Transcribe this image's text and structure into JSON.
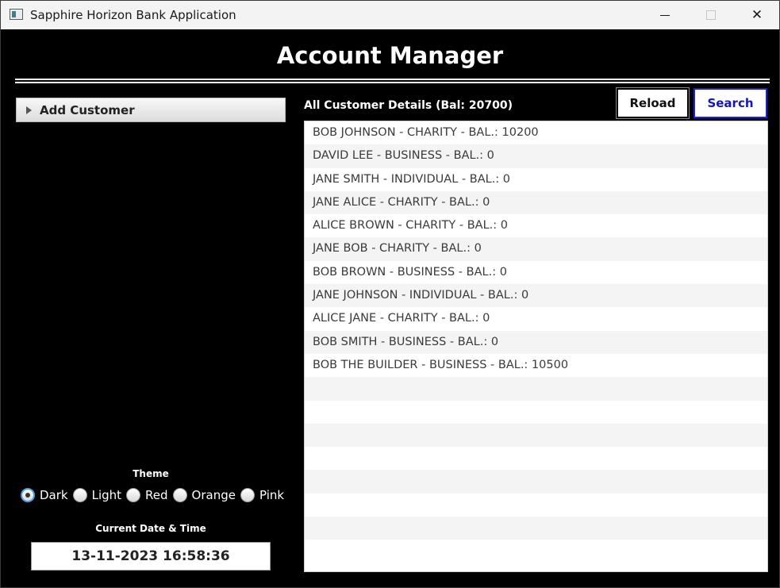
{
  "window": {
    "title": "Sapphire Horizon Bank Application",
    "controls": {
      "minimize": "minimize-icon",
      "maximize": "maximize-icon",
      "close": "close-icon"
    }
  },
  "header": {
    "title": "Account Manager"
  },
  "add_customer": {
    "label": "Add Customer",
    "expanded": false
  },
  "details": {
    "title": "All Customer Details (Bal: 20700)",
    "reload_label": "Reload",
    "search_label": "Search",
    "rows": [
      "BOB JOHNSON - CHARITY - BAL.: 10200",
      "DAVID LEE - BUSINESS - BAL.: 0",
      "JANE SMITH - INDIVIDUAL - BAL.: 0",
      "JANE ALICE - CHARITY - BAL.: 0",
      "ALICE BROWN - CHARITY - BAL.: 0",
      "JANE BOB - CHARITY - BAL.: 0",
      "BOB BROWN - BUSINESS - BAL.: 0",
      "JANE JOHNSON - INDIVIDUAL - BAL.: 0",
      "ALICE JANE - CHARITY - BAL.: 0",
      "BOB SMITH - BUSINESS - BAL.: 0",
      "BOB THE BUILDER - BUSINESS - BAL.: 10500"
    ]
  },
  "theme": {
    "label": "Theme",
    "options": [
      "Dark",
      "Light",
      "Red",
      "Orange",
      "Pink"
    ],
    "selected": "Dark"
  },
  "datetime": {
    "label": "Current Date & Time",
    "value": "13-11-2023 16:58:36"
  },
  "colors": {
    "background": "#000000",
    "search_accent": "#1f1fd6",
    "radio_focus": "#4a9fe0"
  }
}
